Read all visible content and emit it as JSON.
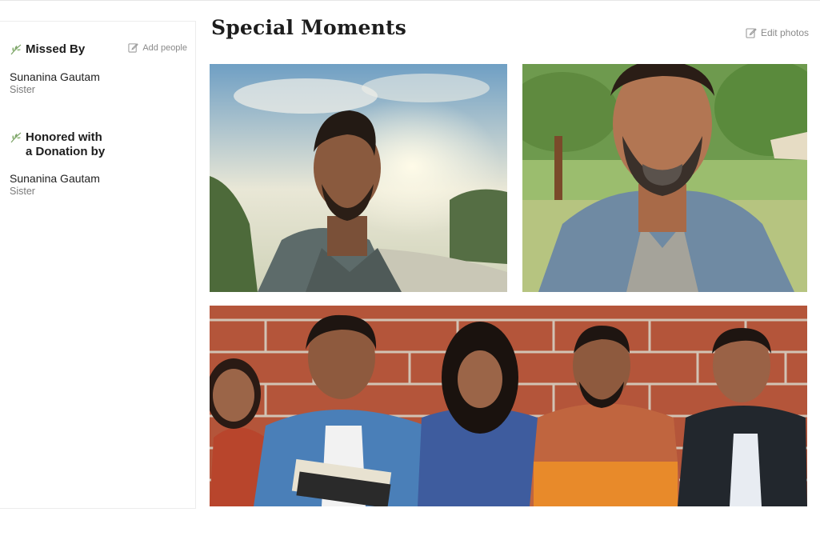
{
  "sidebar": {
    "missed_by": {
      "title": "Missed By",
      "add_label": "Add people",
      "person": {
        "name": "Sunanina Gautam",
        "relation": "Sister"
      }
    },
    "honored": {
      "title_line1": "Honored with",
      "title_line2": "a Donation by",
      "person": {
        "name": "Sunanina Gautam",
        "relation": "Sister"
      }
    }
  },
  "main": {
    "title": "Special Moments",
    "edit_label": "Edit photos",
    "photos": [
      {
        "icon": "photo-man-river"
      },
      {
        "icon": "photo-man-beard-park"
      },
      {
        "icon": "photo-group-brick-wall"
      }
    ]
  },
  "colors": {
    "leaf": "#7fa66b",
    "muted": "#8a8a8a",
    "text": "#1d1d1d"
  }
}
